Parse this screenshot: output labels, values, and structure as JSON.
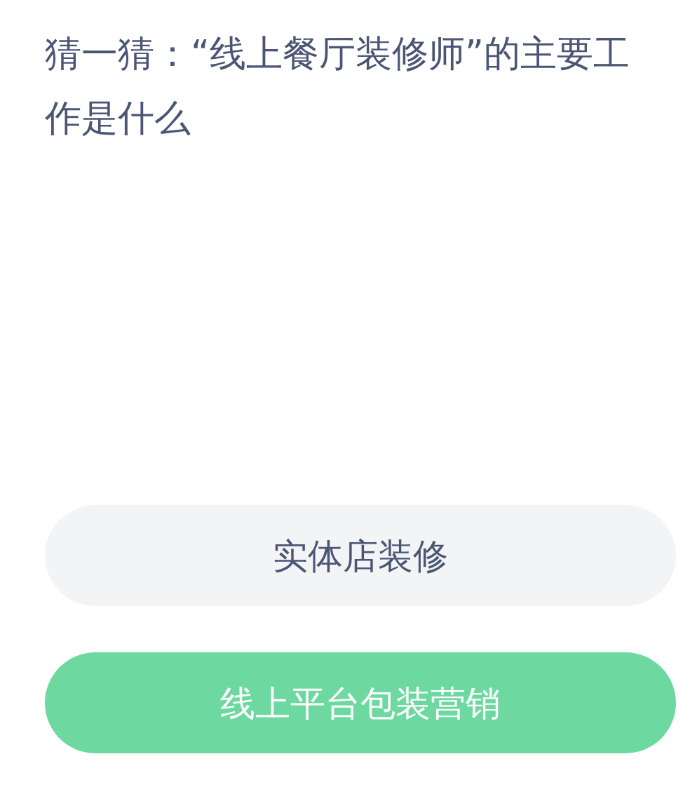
{
  "question": "猜一猜：“线上餐厅装修师”的主要工作是什么",
  "options": [
    {
      "label": "实体店装修",
      "selected": false
    },
    {
      "label": "线上平台包装营销",
      "selected": true
    }
  ]
}
